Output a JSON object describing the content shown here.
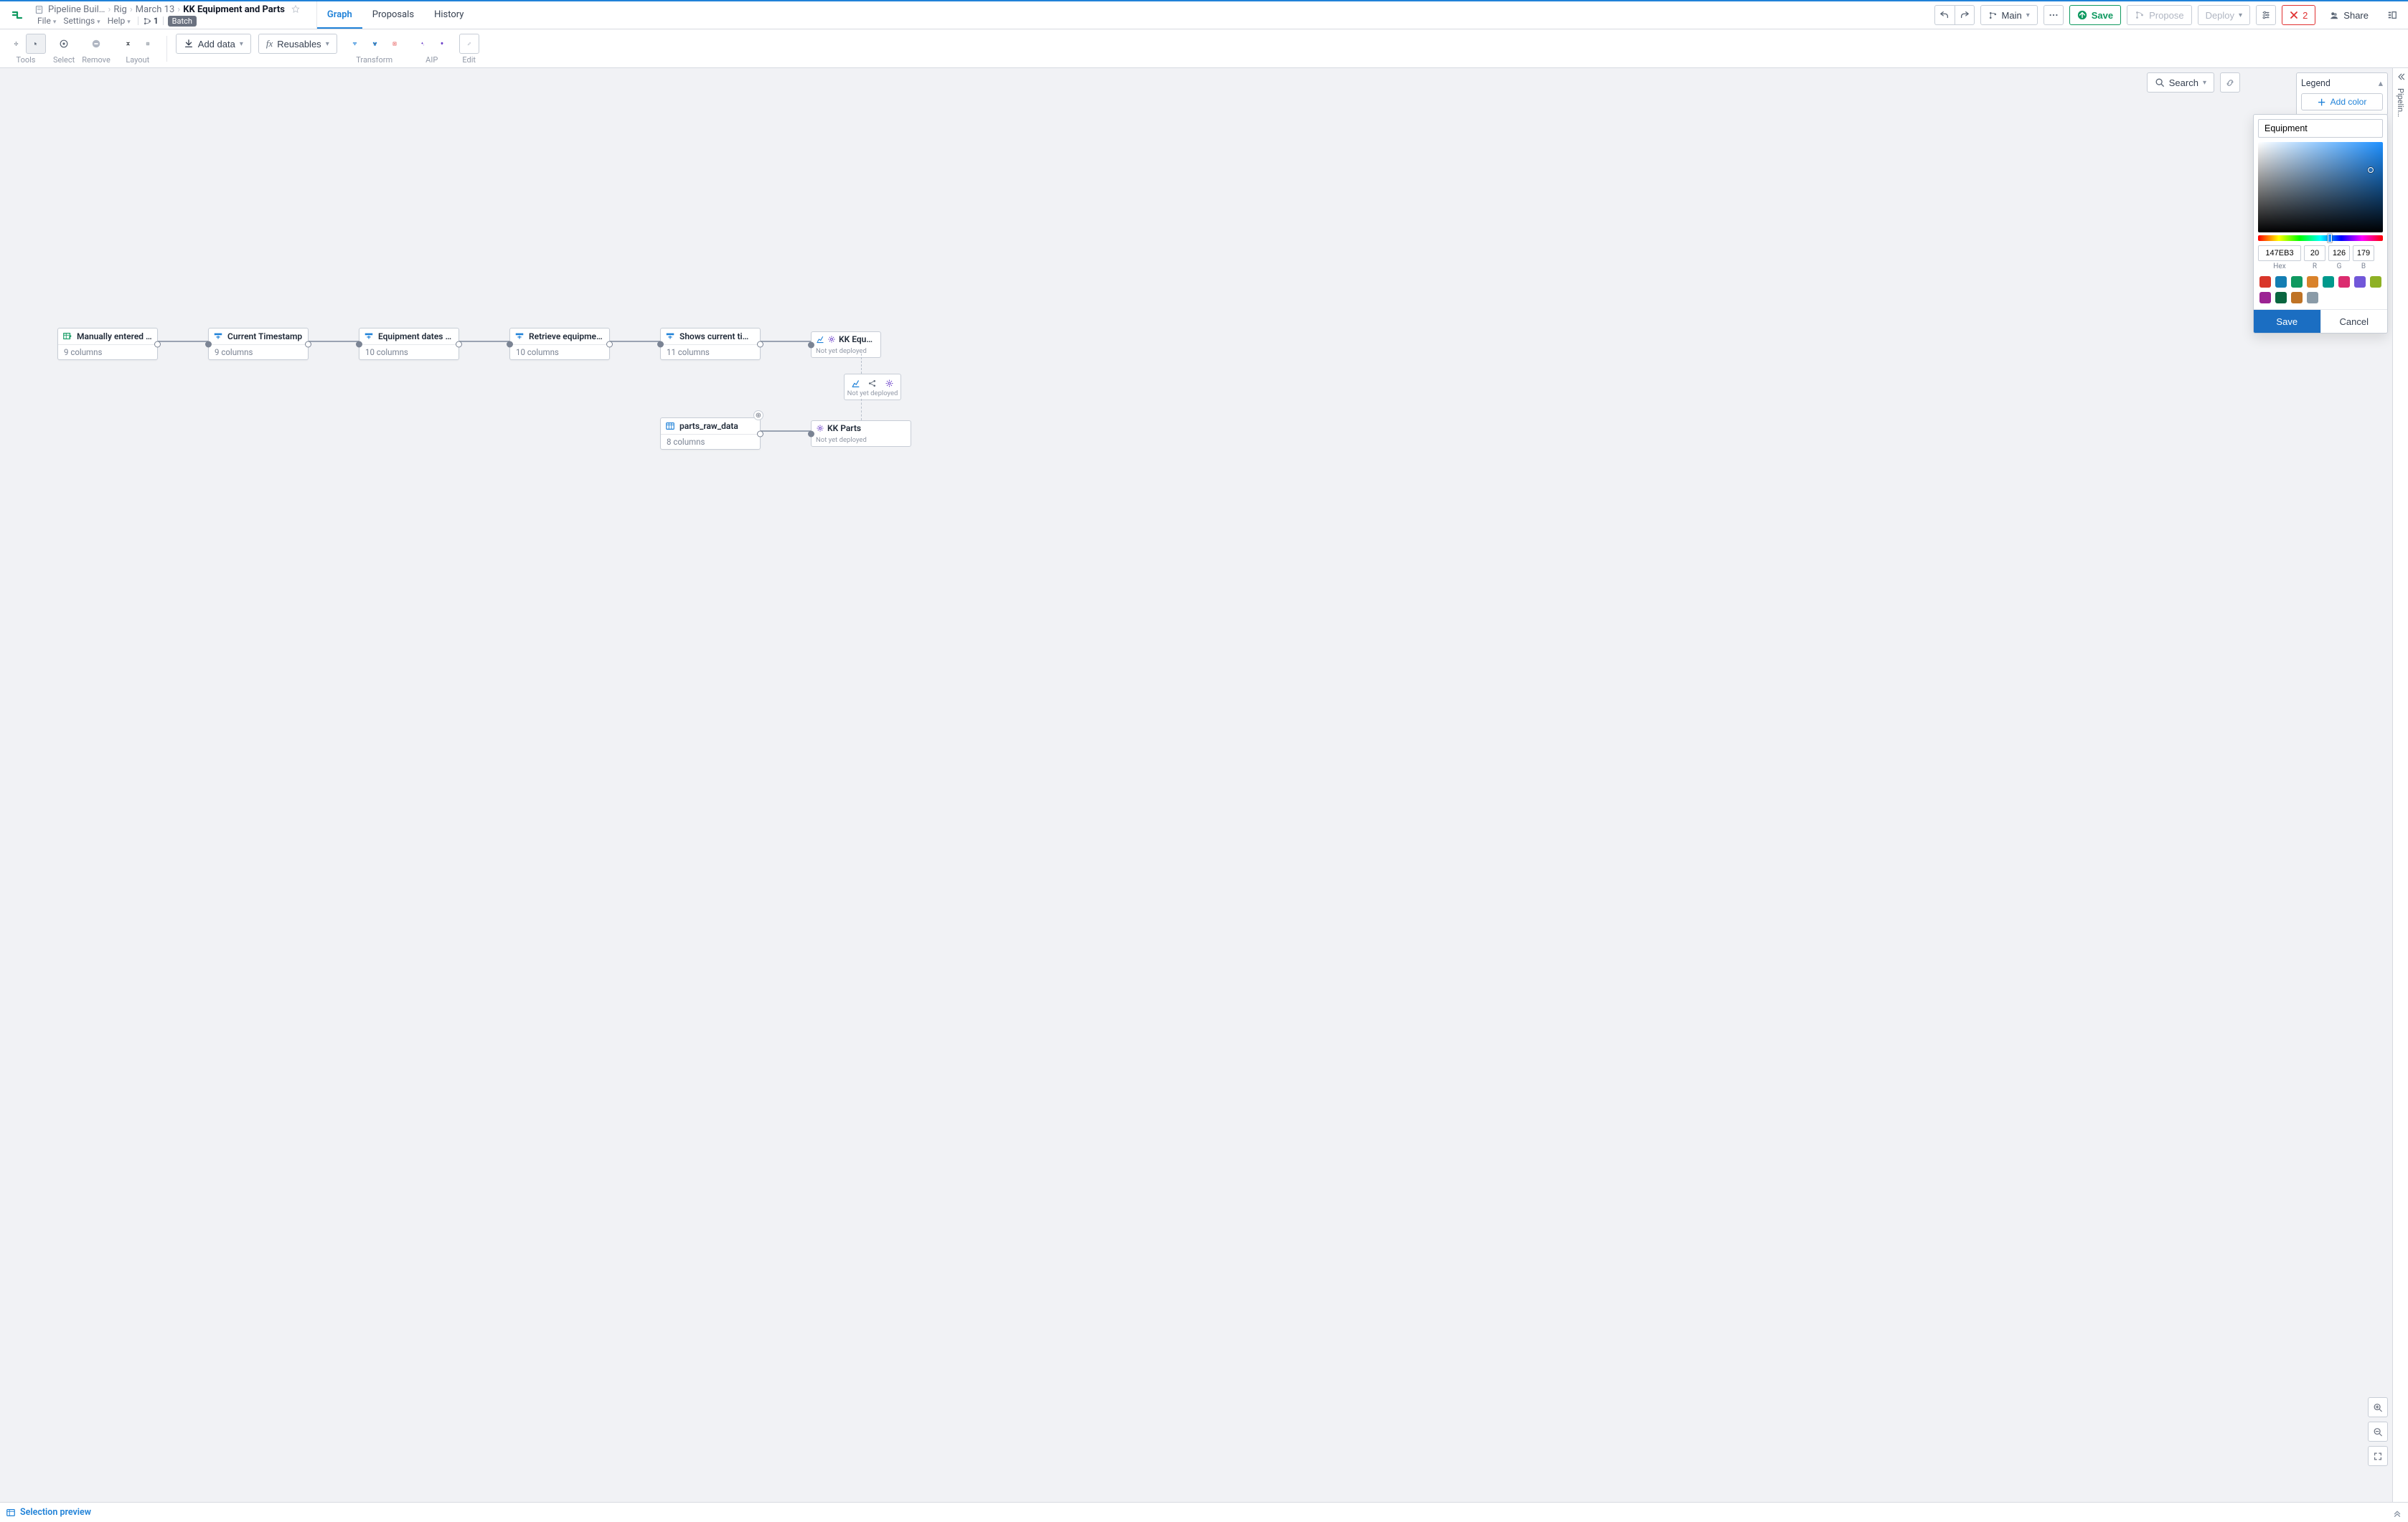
{
  "breadcrumbs": {
    "root": "Pipeline Buil…",
    "level1": "Rig",
    "level2": "March 13",
    "current": "KK Equipment and Parts"
  },
  "sub_menu": {
    "file": "File",
    "settings": "Settings",
    "help": "Help",
    "branch_count": "1",
    "batch_label": "Batch"
  },
  "tabs": {
    "graph": "Graph",
    "proposals": "Proposals",
    "history": "History"
  },
  "top_actions": {
    "branch": "Main",
    "save": "Save",
    "propose": "Propose",
    "deploy": "Deploy",
    "error_count": "2",
    "share": "Share"
  },
  "toolbar": {
    "tools_label": "Tools",
    "select_label": "Select",
    "remove_label": "Remove",
    "layout_label": "Layout",
    "add_data": "Add data",
    "reusables": "Reusables",
    "transform_label": "Transform",
    "aip_label": "AIP",
    "edit_label": "Edit",
    "search": "Search",
    "legend": "Legend",
    "add_color": "Add color"
  },
  "right_rail": {
    "label": "Pipelin…"
  },
  "color_picker": {
    "name_value": "Equipment",
    "hex": "147EB3",
    "r": "20",
    "g": "126",
    "b": "179",
    "hex_label": "Hex",
    "r_label": "R",
    "g_label": "G",
    "b_label": "B",
    "save": "Save",
    "cancel": "Cancel",
    "swatches": [
      "#d9362a",
      "#147eb3",
      "#0f9960",
      "#d9822b",
      "#00998c",
      "#db2c6f",
      "#7157d9",
      "#8eb125",
      "#9b2393",
      "#0a6640",
      "#bf7326",
      "#8a9ba8"
    ]
  },
  "nodes": [
    {
      "title": "Manually entered table",
      "sub": "9 columns",
      "type": "table"
    },
    {
      "title": "Current Timestamp",
      "sub": "9 columns",
      "type": "transform"
    },
    {
      "title": "Equipment dates and ma…",
      "sub": "10 columns",
      "type": "transform"
    },
    {
      "title": "Retrieve equipment IDs.",
      "sub": "10 columns",
      "type": "transform"
    },
    {
      "title": "Shows current time upd…",
      "sub": "11 columns",
      "type": "transform"
    },
    {
      "title": "parts_raw_data",
      "sub": "8 columns",
      "type": "dataset"
    }
  ],
  "outputs": [
    {
      "title": "KK Equ…",
      "status": "Not yet deployed"
    },
    {
      "title": "",
      "status": "Not yet deployed"
    },
    {
      "title": "KK Parts",
      "status": "Not yet deployed"
    }
  ],
  "bottom": {
    "selection_preview": "Selection preview"
  }
}
